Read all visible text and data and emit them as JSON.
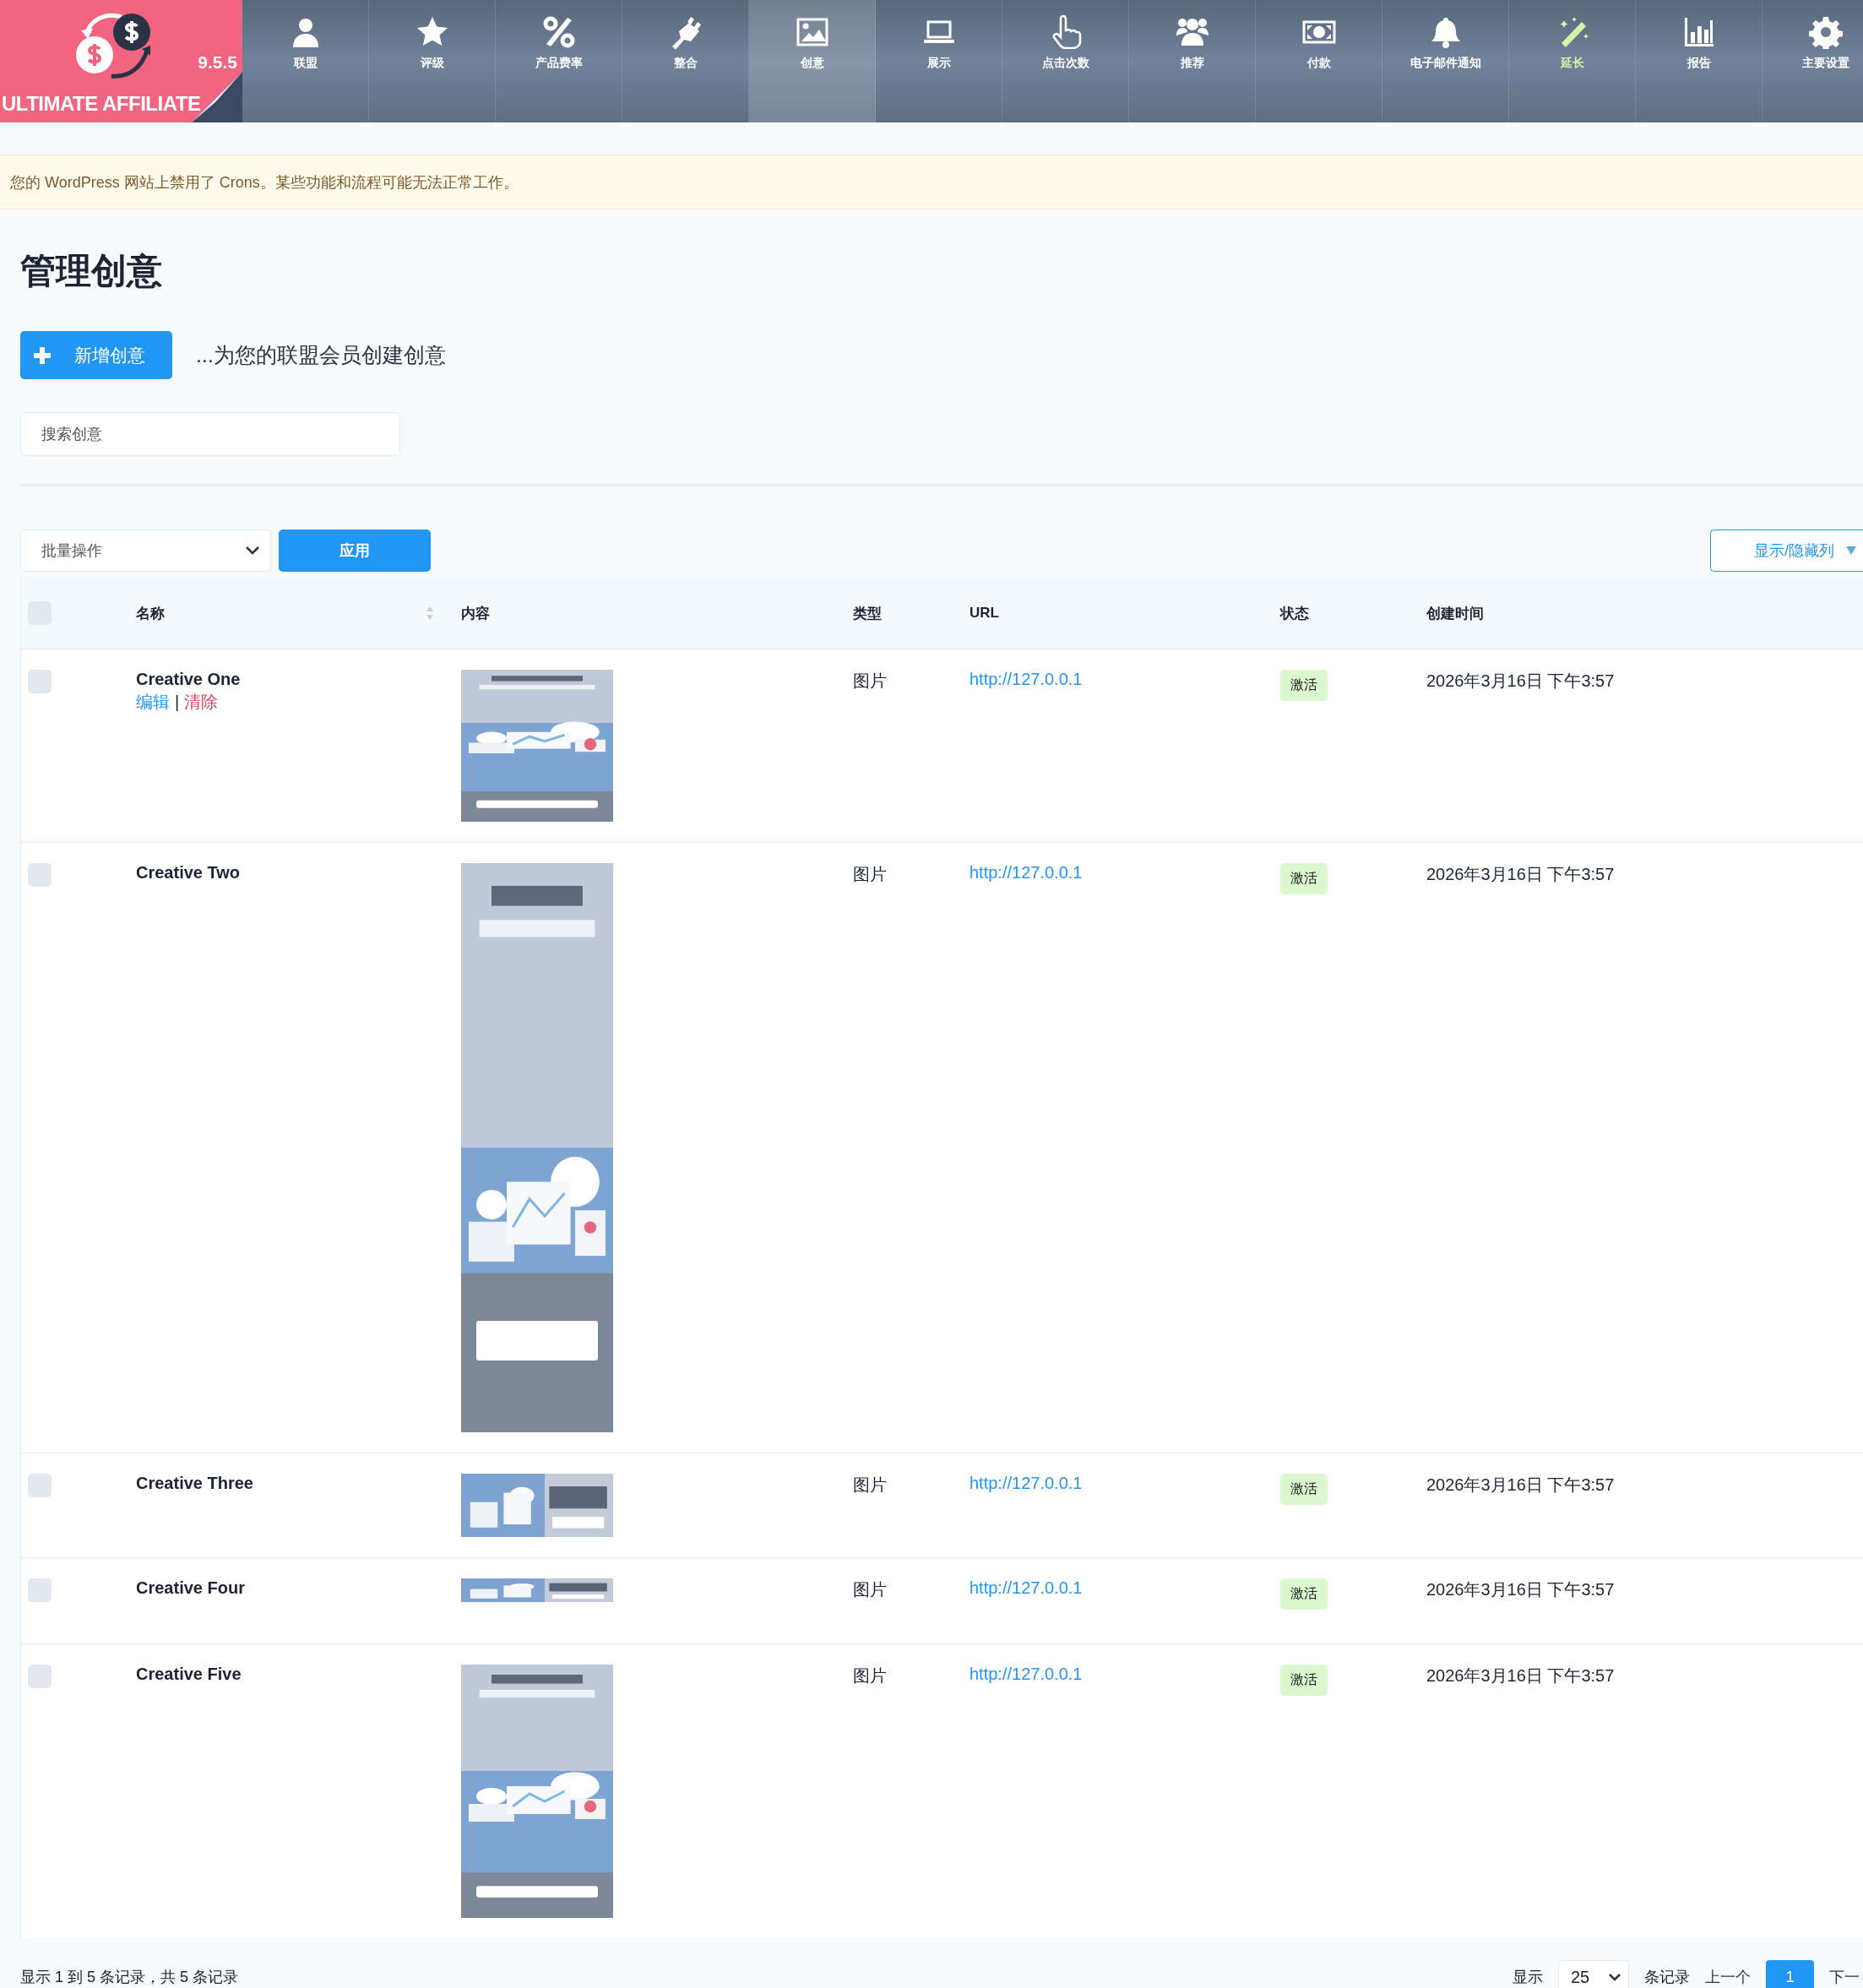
{
  "nav": {
    "logo": {
      "version": "9.5.5",
      "name": "ULTIMATE AFFILIATE"
    },
    "items": [
      {
        "label": "联盟",
        "selected": false,
        "color": "#ffffff"
      },
      {
        "label": "评级",
        "selected": false,
        "color": "#ffffff"
      },
      {
        "label": "产品费率",
        "selected": false,
        "color": "#ffffff"
      },
      {
        "label": "整合",
        "selected": false,
        "color": "#ffffff"
      },
      {
        "label": "创意",
        "selected": true,
        "color": "#ffffff"
      },
      {
        "label": "展示",
        "selected": false,
        "color": "#ffffff"
      },
      {
        "label": "点击次数",
        "selected": false,
        "color": "#ffffff"
      },
      {
        "label": "推荐",
        "selected": false,
        "color": "#ffffff"
      },
      {
        "label": "付款",
        "selected": false,
        "color": "#ffffff"
      },
      {
        "label": "电子邮件通知",
        "selected": false,
        "color": "#ffffff"
      },
      {
        "label": "延长",
        "selected": false,
        "color": "#d7f5a8"
      },
      {
        "label": "报告",
        "selected": false,
        "color": "#ffffff"
      },
      {
        "label": "主要设置",
        "selected": false,
        "color": "#ffffff"
      }
    ]
  },
  "notice": "您的 WordPress 网站上禁用了 Crons。某些功能和流程可能无法正常工作。",
  "page_title": "管理创意",
  "add_button": "新增创意",
  "add_hint": "...为您的联盟会员创建创意",
  "search": {
    "placeholder": "搜索创意"
  },
  "bulk_action": "批量操作",
  "apply_button": "应用",
  "columns_button": "显示/隐藏列",
  "table": {
    "select_all": {
      "checked": false
    },
    "columns": [
      {
        "label": "名称",
        "sortable": true
      },
      {
        "label": "内容",
        "sortable": false
      },
      {
        "label": "类型",
        "sortable": false
      },
      {
        "label": "URL",
        "sortable": false
      },
      {
        "label": "状态",
        "sortable": false
      },
      {
        "label": "创建时间",
        "sortable": false
      }
    ],
    "rows": [
      {
        "checked": false,
        "name": "Creative One",
        "actions": [
          {
            "kind": "edit",
            "label": "编辑"
          },
          {
            "kind": "delete",
            "label": "清除"
          }
        ],
        "action_separator": "|",
        "type": "图片",
        "url": "http://127.0.0.1",
        "status": "激活",
        "created": "2026年3月16日 下午3:57"
      },
      {
        "checked": false,
        "name": "Creative Two",
        "type": "图片",
        "url": "http://127.0.0.1",
        "status": "激活",
        "created": "2026年3月16日 下午3:57"
      },
      {
        "checked": false,
        "name": "Creative Three",
        "type": "图片",
        "url": "http://127.0.0.1",
        "status": "激活",
        "created": "2026年3月16日 下午3:57"
      },
      {
        "checked": false,
        "name": "Creative Four",
        "type": "图片",
        "url": "http://127.0.0.1",
        "status": "激活",
        "created": "2026年3月16日 下午3:57"
      },
      {
        "checked": false,
        "name": "Creative Five",
        "type": "图片",
        "url": "http://127.0.0.1",
        "status": "激活",
        "created": "2026年3月16日 下午3:57"
      }
    ]
  },
  "footer": {
    "summary": "显示 1 到 5 条记录，共 5 条记录",
    "show_label": "显示",
    "page_size": "25",
    "records_label": "条记录",
    "prev": "上一个",
    "pages": [
      {
        "label": "1",
        "selected": true
      }
    ],
    "next": "下一"
  }
}
